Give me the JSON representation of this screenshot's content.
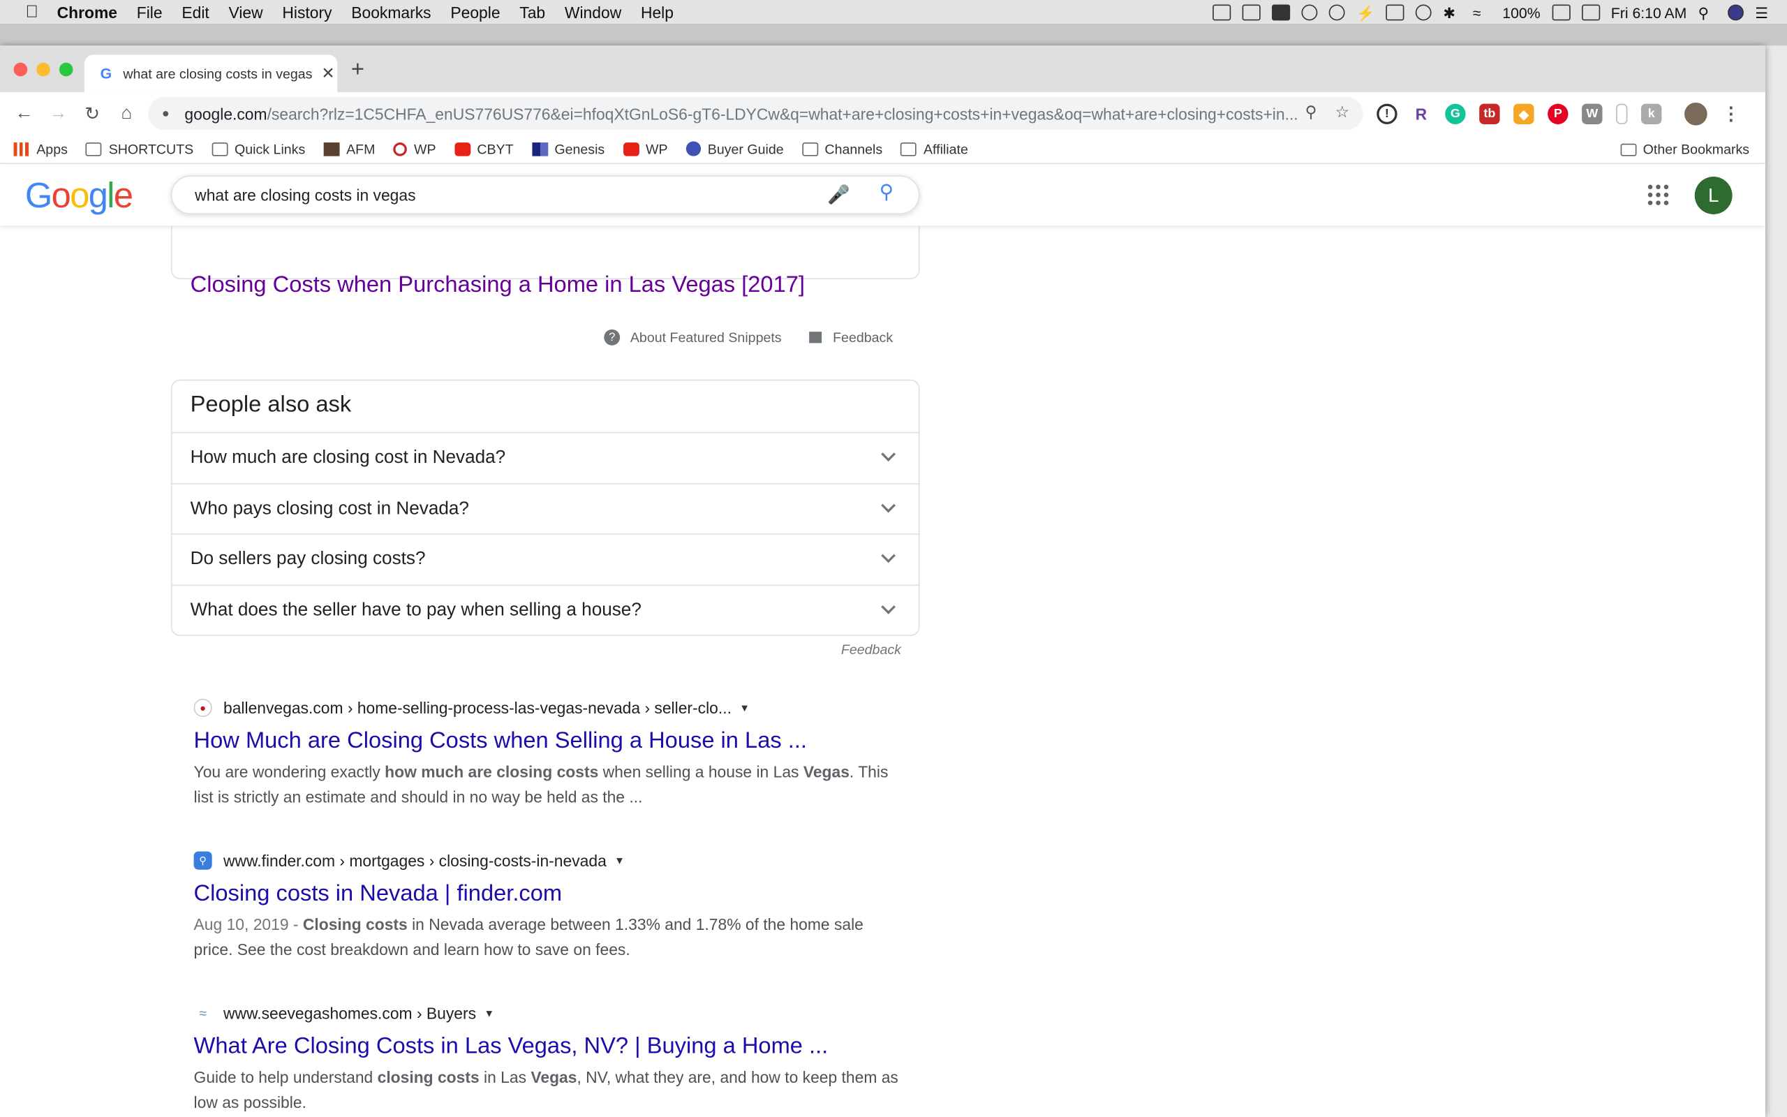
{
  "menubar": {
    "items": [
      "Chrome",
      "File",
      "Edit",
      "View",
      "History",
      "Bookmarks",
      "People",
      "Tab",
      "Window",
      "Help"
    ],
    "battery": "100%",
    "clock": "Fri 6:10 AM"
  },
  "tab": {
    "title": "what are closing costs in vegas",
    "newtab": "+"
  },
  "omnibox": {
    "host": "google.com",
    "path": "/search?rlz=1C5CHFA_enUS776US776&ei=hfoqXtGnLoS6-gT6-LDYCw&q=what+are+closing+costs+in+vegas&oq=what+are+closing+costs+in..."
  },
  "bookmarks": {
    "items": [
      "Apps",
      "SHORTCUTS",
      "Quick Links",
      "AFM",
      "WP",
      "CBYT",
      "Genesis",
      "WP",
      "Buyer Guide",
      "Channels",
      "Affiliate"
    ],
    "other": "Other Bookmarks"
  },
  "search": {
    "query": "what are closing costs in vegas",
    "avatar": "L"
  },
  "featured": {
    "title": "Closing Costs when Purchasing a Home in Las Vegas [2017]",
    "about": "About Featured Snippets",
    "feedback": "Feedback"
  },
  "paa": {
    "heading": "People also ask",
    "questions": [
      "How much are closing cost in Nevada?",
      "Who pays closing cost in Nevada?",
      "Do sellers pay closing costs?",
      "What does the seller have to pay when selling a house?"
    ],
    "feedback": "Feedback"
  },
  "results": [
    {
      "cite": "ballenvegas.com › home-selling-process-las-vegas-nevada › seller-clo...",
      "title": "How Much are Closing Costs when Selling a House in Las ...",
      "snippet": [
        "You are wondering exactly ",
        "how much are closing costs",
        " when selling a house in Las ",
        "Vegas",
        ". This list is strictly an estimate and should in no way be held as the ..."
      ]
    },
    {
      "cite": "www.finder.com › mortgages › closing-costs-in-nevada",
      "title": "Closing costs in Nevada | finder.com",
      "date": "Aug 10, 2019 - ",
      "snippet": [
        "Closing costs",
        " in Nevada average between 1.33% and 1.78% of the home sale price. See the cost breakdown and learn how to save on fees."
      ]
    },
    {
      "cite": "www.seevegashomes.com › Buyers",
      "title": "What Are Closing Costs in Las Vegas, NV? | Buying a Home ...",
      "snippet": [
        "Guide to help understand ",
        "closing costs",
        " in Las ",
        "Vegas",
        ", NV, what they are, and how to keep them as low as possible."
      ]
    }
  ],
  "colors": {
    "link": "#1a0dab",
    "visited": "#660099",
    "googleBlue": "#4285f4"
  }
}
